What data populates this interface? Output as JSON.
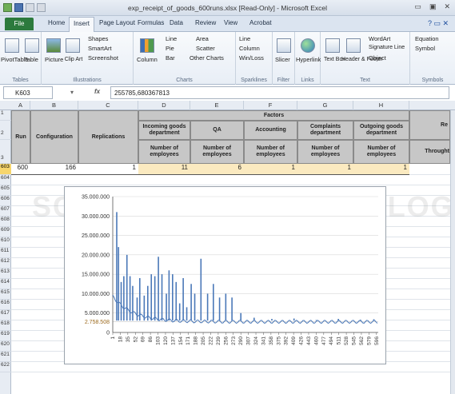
{
  "window": {
    "title": "exp_receipt_of_goods_600runs.xlsx [Read-Only] - Microsoft Excel",
    "controls": [
      "▭",
      "▣",
      "✕"
    ]
  },
  "tabs": [
    "File",
    "Home",
    "Insert",
    "Page Layout",
    "Formulas",
    "Data",
    "Review",
    "View",
    "Acrobat"
  ],
  "active_tab": "Insert",
  "ribbon": {
    "tables": {
      "label": "Tables",
      "pivot": "PivotTable",
      "table": "Table"
    },
    "illustrations": {
      "label": "Illustrations",
      "picture": "Picture",
      "clipart": "Clip Art",
      "shapes": "Shapes",
      "smartart": "SmartArt",
      "screenshot": "Screenshot"
    },
    "charts": {
      "label": "Charts",
      "column": "Column",
      "line": "Line",
      "pie": "Pie",
      "bar": "Bar",
      "area": "Area",
      "scatter": "Scatter",
      "other": "Other Charts"
    },
    "sparklines": {
      "label": "Sparklines",
      "line": "Line",
      "column": "Column",
      "winloss": "Win/Loss"
    },
    "filter": {
      "label": "Filter",
      "slicer": "Slicer"
    },
    "links": {
      "label": "Links",
      "hyperlink": "Hyperlink"
    },
    "text": {
      "label": "Text",
      "textbox": "Text Box",
      "header": "Header & Footer",
      "wordart": "WordArt",
      "signature": "Signature Line",
      "object": "Object"
    },
    "symbols": {
      "label": "Symbols",
      "equation": "Equation",
      "symbol": "Symbol"
    }
  },
  "formula_bar": {
    "cell": "K603",
    "fx": "fx",
    "value": "255785,680367813"
  },
  "columns": [
    "A",
    "B",
    "C",
    "D",
    "E",
    "F",
    "G",
    "H"
  ],
  "rows": [
    "1",
    "2",
    "3",
    "603",
    "604",
    "605",
    "606",
    "607",
    "608",
    "609",
    "610",
    "611",
    "612",
    "613",
    "614",
    "615",
    "616",
    "617",
    "618",
    "619",
    "620",
    "621",
    "622"
  ],
  "header": {
    "run": "Run",
    "configuration": "Configuration",
    "replications": "Replications",
    "factors": "Factors",
    "departments": [
      "Incoming goods department",
      "QA",
      "Accounting",
      "Complaints department",
      "Outgoing goods department"
    ],
    "number_label": "Number of employees",
    "cut_1": "Re",
    "cut_2": "Throught"
  },
  "row603": {
    "run": "600",
    "configuration": "166",
    "replications": "1",
    "values": [
      "11",
      "6",
      "1",
      "1",
      "1"
    ]
  },
  "watermark": "SCIENCE AND TECHNOLOGY PUBLICATIONS",
  "colors": {
    "series": "#4a78b8",
    "highlight": "#9c6a1e"
  },
  "chart_data": {
    "type": "line",
    "y_ticks": [
      "0",
      "5.000.000",
      "10.000.000",
      "15.000.000",
      "20.000.000",
      "25.000.000",
      "30.000.000",
      "35.000.000"
    ],
    "ylim": [
      0,
      35000000
    ],
    "highlight_label": "2.758.508",
    "highlight_value": 2758508,
    "x_ticks": [
      "1",
      "18",
      "35",
      "52",
      "69",
      "86",
      "103",
      "120",
      "137",
      "154",
      "171",
      "188",
      "205",
      "222",
      "239",
      "256",
      "273",
      "290",
      "307",
      "324",
      "341",
      "358",
      "375",
      "392",
      "409",
      "426",
      "443",
      "460",
      "477",
      "494",
      "511",
      "528",
      "545",
      "562",
      "579",
      "596"
    ],
    "x_range": [
      1,
      600
    ],
    "spikes": [
      {
        "x": 10,
        "y": 31000000
      },
      {
        "x": 14,
        "y": 22000000
      },
      {
        "x": 20,
        "y": 13000000
      },
      {
        "x": 26,
        "y": 14500000
      },
      {
        "x": 33,
        "y": 20000000
      },
      {
        "x": 40,
        "y": 14500000
      },
      {
        "x": 46,
        "y": 12000000
      },
      {
        "x": 56,
        "y": 9000000
      },
      {
        "x": 62,
        "y": 14000000
      },
      {
        "x": 72,
        "y": 9500000
      },
      {
        "x": 80,
        "y": 12000000
      },
      {
        "x": 88,
        "y": 15000000
      },
      {
        "x": 96,
        "y": 14500000
      },
      {
        "x": 104,
        "y": 19500000
      },
      {
        "x": 112,
        "y": 15000000
      },
      {
        "x": 122,
        "y": 10000000
      },
      {
        "x": 128,
        "y": 16000000
      },
      {
        "x": 136,
        "y": 15000000
      },
      {
        "x": 144,
        "y": 13000000
      },
      {
        "x": 152,
        "y": 7500000
      },
      {
        "x": 160,
        "y": 14000000
      },
      {
        "x": 168,
        "y": 6500000
      },
      {
        "x": 178,
        "y": 12500000
      },
      {
        "x": 186,
        "y": 10000000
      },
      {
        "x": 200,
        "y": 19000000
      },
      {
        "x": 215,
        "y": 10000000
      },
      {
        "x": 228,
        "y": 12500000
      },
      {
        "x": 242,
        "y": 9000000
      },
      {
        "x": 256,
        "y": 10000000
      },
      {
        "x": 270,
        "y": 9000000
      },
      {
        "x": 290,
        "y": 5000000
      },
      {
        "x": 320,
        "y": 3800000
      },
      {
        "x": 360,
        "y": 3500000
      },
      {
        "x": 410,
        "y": 3600000
      },
      {
        "x": 460,
        "y": 3200000
      },
      {
        "x": 510,
        "y": 3500000
      },
      {
        "x": 560,
        "y": 3300000
      },
      {
        "x": 590,
        "y": 3400000
      }
    ]
  }
}
